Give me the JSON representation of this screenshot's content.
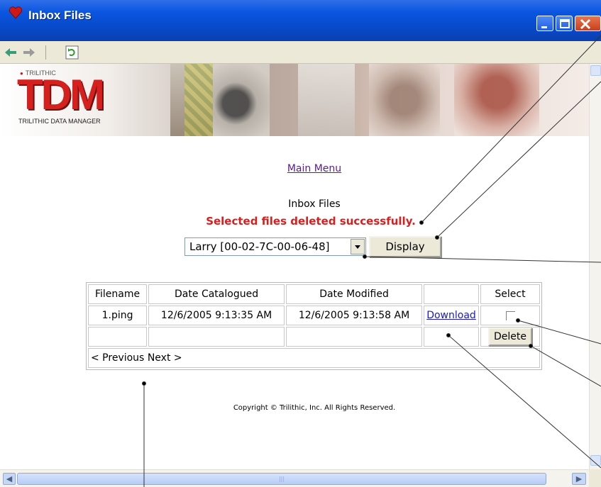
{
  "window": {
    "title": "Inbox Files",
    "icon": "heart-icon",
    "controls": [
      "minimize-icon",
      "maximize-icon",
      "close-icon"
    ]
  },
  "toolbar": {
    "back_icon": "back-arrow-icon",
    "forward_icon": "forward-arrow-icon",
    "refresh_icon": "refresh-icon"
  },
  "banner": {
    "brand_small": "TRILITHIC",
    "logo": "TDM",
    "subtitle": "TRILITHIC DATA MANAGER"
  },
  "nav": {
    "main_menu_label": "Main Menu"
  },
  "page": {
    "heading": "Inbox Files",
    "status_message": "Selected files deleted successfully."
  },
  "device_select": {
    "selected_value": "Larry [00-02-7C-00-06-48]",
    "display_label": "Display"
  },
  "table": {
    "headers": [
      "Filename",
      "Date Catalogued",
      "Date Modified",
      "",
      "Select"
    ],
    "rows": [
      {
        "filename": "1.ping",
        "date_catalogued": "12/6/2005 9:13:35 AM",
        "date_modified": "12/6/2005 9:13:58 AM",
        "action_label": "Download",
        "selected": false
      }
    ],
    "delete_label": "Delete",
    "pager": {
      "previous_label": "< Previous",
      "next_label": "Next >"
    }
  },
  "footer": {
    "copyright": "Copyright © Trilithic, Inc. All Rights Reserved."
  },
  "colors": {
    "titlebar": "#0a55e0",
    "status_message": "#d6201f",
    "logo": "#d5201e",
    "link_visited": "#5a1d8c",
    "link": "#1a1ac8"
  }
}
